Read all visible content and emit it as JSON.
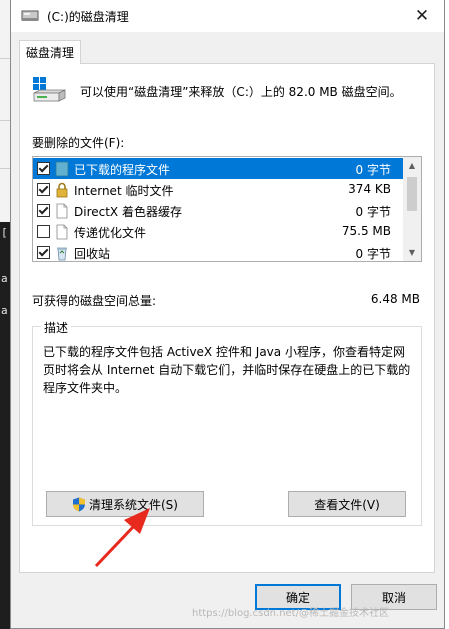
{
  "window": {
    "title": "(C:)的磁盘清理",
    "close_glyph": "✕"
  },
  "tab": {
    "label": "磁盘清理"
  },
  "intro_text": "可以使用“磁盘清理”来释放（C:）上的 82.0 MB 磁盘空间。",
  "files_label": "要删除的文件(F):",
  "files": [
    {
      "name": "已下载的程序文件",
      "size": "0 字节",
      "checked": true,
      "selected": true,
      "icon": "folder-icon"
    },
    {
      "name": "Internet 临时文件",
      "size": "374 KB",
      "checked": true,
      "selected": false,
      "icon": "lock-icon"
    },
    {
      "name": "DirectX 着色器缓存",
      "size": "0 字节",
      "checked": true,
      "selected": false,
      "icon": "document-icon"
    },
    {
      "name": "传递优化文件",
      "size": "75.5 MB",
      "checked": false,
      "selected": false,
      "icon": "document-icon"
    },
    {
      "name": "回收站",
      "size": "0 字节",
      "checked": true,
      "selected": false,
      "icon": "recycle-bin-icon"
    }
  ],
  "total_label": "可获得的磁盘空间总量:",
  "total_value": "6.48 MB",
  "description": {
    "legend": "描述",
    "text": "已下载的程序文件包括 ActiveX 控件和 Java 小程序，你查看特定网页时将会从 Internet 自动下载它们，并临时保存在硬盘上的已下载的程序文件夹中。"
  },
  "buttons": {
    "clean_system": "清理系统文件(S)",
    "view_files": "查看文件(V)",
    "ok": "确定",
    "cancel": "取消"
  },
  "watermark": "https://blog.csdn.net/@稀土掘金技术社区",
  "colors": {
    "selection": "#0078d7",
    "annotation_arrow": "#e8291d"
  }
}
